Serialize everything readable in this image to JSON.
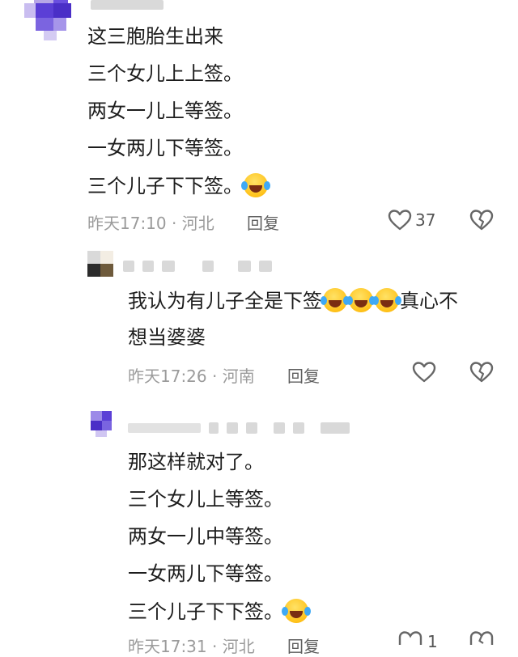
{
  "comments": [
    {
      "lines": [
        "这三胞胎生出来",
        "三个女儿上上签。",
        "两女一儿上等签。",
        "一女两儿下等签。",
        "三个儿子下下签。"
      ],
      "emoji": "laughing-tears-emoji",
      "time_location": "昨天17:10 · 河北",
      "reply_label": "回复",
      "likes": "37"
    },
    {
      "line1": "我认为有儿子全是下签",
      "line1_tail": "真心不",
      "line2": "想当婆婆",
      "emoji": "laughing-tears-emoji",
      "time_location": "昨天17:26 · 河南",
      "reply_label": "回复"
    },
    {
      "lines": [
        "那这样就对了。",
        "三个女儿上等签。",
        "两女一儿中等签。",
        "一女两儿下等签。",
        "三个儿子下下签。"
      ],
      "emoji": "laughing-tears-emoji",
      "time_location": "昨天17:31 · 河北",
      "reply_label": "回复",
      "likes": "1"
    }
  ],
  "icons": {
    "like": "heart-outline-icon",
    "dislike": "broken-heart-icon"
  },
  "colors": {
    "text": "#1d1d1d",
    "meta": "#9b9b9b",
    "icon": "#666666",
    "avatar_purple": "#5b3fd6"
  }
}
